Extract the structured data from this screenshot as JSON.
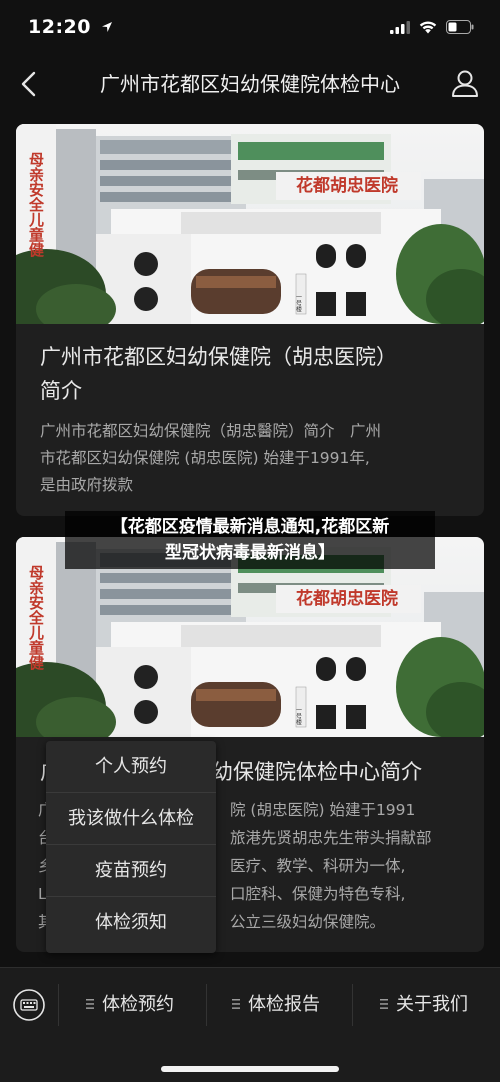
{
  "status_bar": {
    "time": "12:20",
    "location_icon": "location-arrow-icon",
    "signal_icon": "cellular-signal-icon",
    "wifi_icon": "wifi-icon",
    "battery_icon": "battery-icon"
  },
  "nav": {
    "title": "广州市花都区妇幼保健院体检中心",
    "back_icon": "back-chevron-icon",
    "user_icon": "user-profile-icon"
  },
  "cards": [
    {
      "image_text": "母亲安全儿童健",
      "building_sign": "花都胡忠医院",
      "building_plate": "一号楼",
      "title_line1": "广州市花都区妇幼保健院（胡忠医院）",
      "title_line2": "简介",
      "desc_line1": "广州市花都区妇幼保健院（胡忠醫院）简介　广州",
      "desc_line2": "市花都区妇幼保健院 (胡忠医院) 始建于1991年,",
      "desc_line3": "是由政府拨款"
    },
    {
      "image_text": "母亲安全儿童健",
      "building_sign": "花都胡忠医院",
      "building_plate": "一号楼",
      "title_visible": "幼保健院体检中心简介",
      "title_left_edge": "广",
      "desc_line1": "院 (胡忠医院) 始建于1991",
      "desc_line2": "旅港先贤胡忠先生带头捐献部",
      "desc_line3": "医疗、教学、科研为一体,",
      "desc_line4": "口腔科、保健为特色专科,",
      "desc_line5": "公立三级妇幼保健院。",
      "left_edge_chars": [
        "广",
        "台",
        "乡",
        "L",
        "其"
      ]
    }
  ],
  "overlay": {
    "line1": "【花都区疫情最新消息通知,花都区新",
    "line2": "型冠状病毒最新消息】"
  },
  "popup_menu": {
    "items": [
      "个人预约",
      "我该做什么体检",
      "疫苗预约",
      "体检须知"
    ]
  },
  "bottom_bar": {
    "keyboard_icon": "keyboard-icon",
    "tabs": [
      "体检预约",
      "体检报告",
      "关于我们"
    ],
    "tab_icon": "menu-lines-icon"
  },
  "colors": {
    "background": "#111111",
    "card": "#1f1f1f",
    "popup": "#2a2a2a",
    "bottom_bar": "#1c1c1c"
  }
}
